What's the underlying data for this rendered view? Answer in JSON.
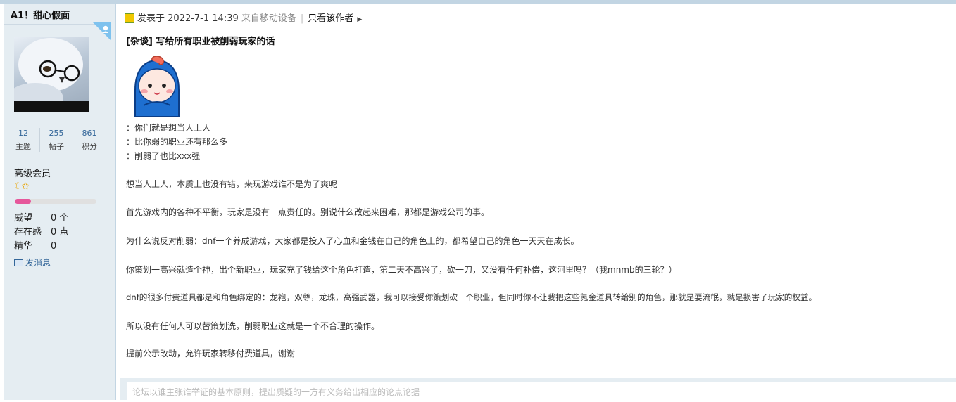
{
  "user": {
    "name": "A1！甜心假面",
    "stats": [
      {
        "value": "12",
        "label": "主题"
      },
      {
        "value": "255",
        "label": "帖子"
      },
      {
        "value": "861",
        "label": "积分"
      }
    ],
    "group": "高级会员",
    "rank_icons": "☾✩",
    "progress": 0.2,
    "fields": [
      {
        "key": "威望",
        "value": "0 个"
      },
      {
        "key": "存在感",
        "value": "0 点"
      },
      {
        "key": "精华",
        "value": "0"
      }
    ],
    "send_message": "发消息"
  },
  "post": {
    "posted_label": "发表于 2022-7-1 14:39",
    "device": "来自移动设备",
    "only_author": "只看该作者",
    "title": "[杂谈] 写给所有职业被削弱玩家的话",
    "quotes": [
      "：你们就是想当人上人",
      "：比你弱的职业还有那么多",
      "：削弱了也比xxx强"
    ],
    "paragraphs": [
      "想当人上人，本质上也没有错，来玩游戏谁不是为了爽呢",
      "首先游戏内的各种不平衡，玩家是没有一点责任的。别说什么改起来困难，那都是游戏公司的事。",
      "为什么说反对削弱：dnf一个养成游戏，大家都是投入了心血和金钱在自己的角色上的，都希望自己的角色一天天在成长。",
      "你策划一高兴就造个神，出个新职业，玩家充了钱给这个角色打造，第二天不高兴了，砍一刀，又没有任何补偿，这河里吗？（我mnmb的三轮？）",
      "dnf的很多付费道具都是和角色绑定的：龙袍，双尊，龙珠，高强武器，我可以接受你策划砍一个职业，但同时你不让我把这些氪金道具转给别的角色，那就是耍流氓，就是损害了玩家的权益。",
      "所以没有任何人可以替策划洗，削弱职业这就是一个不合理的操作。",
      "提前公示改动，允许玩家转移付费道具，谢谢"
    ]
  },
  "reply": {
    "placeholder": "论坛以谁主张谁举证的基本原则，提出质疑的一方有义务给出相应的论点论据"
  },
  "colors": {
    "sidebar_bg": "#e5edf2",
    "border": "#c2d5e3",
    "link": "#336699",
    "progress_fill": "#e6579b",
    "online_flag": "#7ec2ee"
  }
}
